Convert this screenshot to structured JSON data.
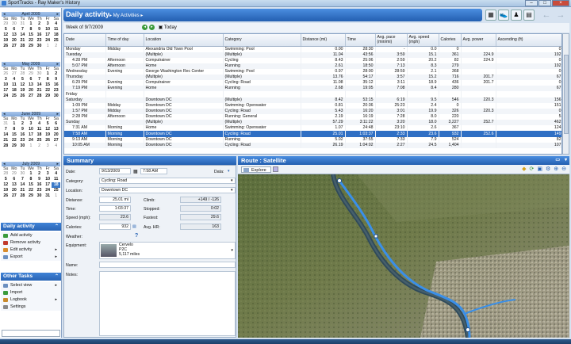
{
  "app": {
    "title": "SportTracks - Ray Maker's History"
  },
  "calendars": [
    {
      "month": "April 2009",
      "dow": [
        "Su",
        "Mo",
        "Tu",
        "We",
        "Th",
        "Fr",
        "Sa"
      ],
      "days": [
        "29",
        "30",
        "31",
        "1",
        "2",
        "3",
        "4",
        "5",
        "6",
        "7",
        "8",
        "9",
        "10",
        "11",
        "12",
        "13",
        "14",
        "15",
        "16",
        "17",
        "18",
        "19",
        "20",
        "21",
        "22",
        "23",
        "24",
        "25",
        "26",
        "27",
        "28",
        "29",
        "30",
        "1",
        "2"
      ]
    },
    {
      "month": "May 2009",
      "dow": [
        "Su",
        "Mo",
        "Tu",
        "We",
        "Th",
        "Fr",
        "Sa"
      ],
      "days": [
        "26",
        "27",
        "28",
        "29",
        "30",
        "1",
        "2",
        "3",
        "4",
        "5",
        "6",
        "7",
        "8",
        "9",
        "10",
        "11",
        "12",
        "13",
        "14",
        "15",
        "16",
        "17",
        "18",
        "19",
        "20",
        "21",
        "22",
        "23",
        "24",
        "25",
        "26",
        "27",
        "28",
        "29",
        "30"
      ]
    },
    {
      "month": "June 2009",
      "dow": [
        "Su",
        "Mo",
        "Tu",
        "We",
        "Th",
        "Fr",
        "Sa"
      ],
      "days": [
        "31",
        "1",
        "2",
        "3",
        "4",
        "5",
        "6",
        "7",
        "8",
        "9",
        "10",
        "11",
        "12",
        "13",
        "14",
        "15",
        "16",
        "17",
        "18",
        "19",
        "20",
        "21",
        "22",
        "23",
        "24",
        "25",
        "26",
        "27",
        "28",
        "29",
        "30",
        "1",
        "2",
        "3",
        "4"
      ]
    },
    {
      "month": "July 2009",
      "dow": [
        "Su",
        "Mo",
        "Tu",
        "We",
        "Th",
        "Fr",
        "Sa"
      ],
      "days": [
        "28",
        "29",
        "30",
        "1",
        "2",
        "3",
        "4",
        "5",
        "6",
        "7",
        "8",
        "9",
        "10",
        "11",
        "12",
        "13",
        "14",
        "15",
        "16",
        "17",
        "18",
        "19",
        "20",
        "21",
        "22",
        "23",
        "24",
        "25",
        "26",
        "27",
        "28",
        "29",
        "30",
        "31",
        "1"
      ]
    }
  ],
  "daily_panel": {
    "title": "Daily activity",
    "items": [
      {
        "label": "Add activity",
        "icon": "add-icon",
        "color": "#3a9a3a"
      },
      {
        "label": "Remove activity",
        "icon": "remove-icon",
        "color": "#c0392b"
      },
      {
        "label": "Edit activity",
        "icon": "edit-icon",
        "color": "#d98c2b",
        "sub": "▸"
      },
      {
        "label": "Export",
        "icon": "export-icon",
        "color": "#6b8fbf",
        "sub": "▸"
      }
    ]
  },
  "other_panel": {
    "title": "Other Tasks",
    "items": [
      {
        "label": "Select view",
        "icon": "select-view-icon",
        "color": "#6b8fbf",
        "sub": "▸"
      },
      {
        "label": "Import",
        "icon": "import-icon",
        "color": "#3a9a3a"
      },
      {
        "label": "Logbook",
        "icon": "logbook-icon",
        "color": "#c98a2b",
        "sub": "▸"
      },
      {
        "label": "Settings",
        "icon": "settings-icon",
        "color": "#888888"
      }
    ]
  },
  "header": {
    "title": "Daily activity",
    "breadcrumb": "▸ My Activities ▸"
  },
  "weekbar": {
    "week": "Week of 9/7/2009",
    "today": "Today"
  },
  "grid": {
    "columns": [
      "Date",
      "Time of day",
      "Location",
      "Category",
      "Distance (mi)",
      "Time",
      "Avg. pace (min/mi)",
      "Avg. speed (mph)",
      "Calories",
      "Avg. power",
      "Ascending (ft)"
    ],
    "rows": [
      [
        "Monday",
        "Midday",
        "Alexandria Old Town Pool",
        "Swimming: Pool",
        "0.00",
        "28:30",
        "-",
        "0.0",
        "0",
        "",
        "0"
      ],
      [
        "Tuesday",
        "",
        "(Multiple)",
        "(Multiple)",
        "11.04",
        "43:56",
        "3:59",
        "15.1",
        "361",
        "224.9",
        "192"
      ],
      [
        "4:28 PM",
        "Afternoon",
        "Computrainer",
        "Cycling",
        "8.43",
        "25:06",
        "2:59",
        "20.2",
        "82",
        "224.9",
        "0"
      ],
      [
        "5:07 PM",
        "Afternoon",
        "Home",
        "Running",
        "2.61",
        "18:50",
        "7:13",
        "8.3",
        "279",
        "",
        "192"
      ],
      [
        "Wednesday",
        "Evening",
        "George Washington Rec Center",
        "Swimming: Pool",
        "0.97",
        "28:00",
        "28:59",
        "2.1",
        "368",
        "",
        "0"
      ],
      [
        "Thursday",
        "",
        "(Multiple)",
        "(Multiple)",
        "13.76",
        "54:17",
        "3:57",
        "15.2",
        "716",
        "201.7",
        "67"
      ],
      [
        "6:29 PM",
        "Evening",
        "Computrainer",
        "Cycling: Road",
        "11.08",
        "35:12",
        "3:11",
        "18.9",
        "436",
        "201.7",
        "0"
      ],
      [
        "7:19 PM",
        "Evening",
        "Home",
        "Running",
        "2.68",
        "19:05",
        "7:08",
        "8.4",
        "280",
        "",
        "67"
      ],
      [
        "Friday",
        "",
        "",
        "",
        "",
        "",
        "",
        "",
        "",
        "",
        ""
      ],
      [
        "Saturday",
        "",
        "Downtown DC",
        "(Multiple)",
        "8.42",
        "53:15",
        "6:19",
        "9.5",
        "546",
        "220.3",
        "156"
      ],
      [
        "1:09 PM",
        "Midday",
        "Downtown DC",
        "Swimming: Openwater",
        "0.81",
        "20:36",
        "25:23",
        "2.4",
        "0",
        "",
        "151"
      ],
      [
        "1:57 PM",
        "Midday",
        "Downtown DC",
        "Cycling: Road",
        "5.43",
        "16:20",
        "3:01",
        "19.9",
        "326",
        "220.3",
        "0"
      ],
      [
        "2:28 PM",
        "Afternoon",
        "Downtown DC",
        "Running: General",
        "2.19",
        "16:19",
        "7:28",
        "8.0",
        "220",
        "",
        "5"
      ],
      [
        "Sunday",
        "",
        "(Multiple)",
        "(Multiple)",
        "57.29",
        "3:11:22",
        "3:20",
        "18.0",
        "3,227",
        "252.7",
        "462"
      ],
      [
        "7:31 AM",
        "Morning",
        "Home",
        "Swimming: Openwater",
        "1.07",
        "24:48",
        "23:10",
        "2.6",
        "367",
        "",
        "124"
      ],
      [
        "7:58 AM",
        "Morning",
        "Downtown DC",
        "Cycling: Road",
        "25.01",
        "1:03:37",
        "2:33",
        "23.6",
        "932",
        "252.6",
        "149"
      ],
      [
        "9:13 AM",
        "Morning",
        "Downtown DC",
        "Running",
        "5.02",
        "37:55",
        "7:33",
        "7.9",
        "524",
        "",
        "82"
      ],
      [
        "10:05 AM",
        "Morning",
        "Downtown DC",
        "Cycling: Road",
        "26.19",
        "1:04:02",
        "2:27",
        "24.5",
        "1,404",
        "",
        "107"
      ]
    ]
  },
  "summary": {
    "title": "Summary",
    "date_label": "Date:",
    "date": "9/13/2009",
    "time": "7:58 AM",
    "data_label": "Data:",
    "category_label": "Category:",
    "category": "Cycling: Road",
    "location_label": "Location:",
    "location": "Downtown DC",
    "distance_label": "Distance:",
    "distance": "25.01 mi",
    "climb_label": "Climb:",
    "climb": "+149 / -126",
    "time_label": "Time:",
    "time_val": "1:03:37",
    "stopped_label": "Stopped:",
    "stopped": "0:02",
    "speed_label": "Speed (mph):",
    "speed": "23.6",
    "fastest_label": "Fastest:",
    "fastest": "29.6",
    "calories_label": "Calories:",
    "calories": "932",
    "hr_label": "Avg. HR:",
    "hr": "163",
    "weather_label": "Weather:",
    "equipment_label": "Equipment:",
    "equip_name": "Cervelo",
    "equip_model": "P2C",
    "equip_miles": "5,117 miles",
    "name_label": "Name:",
    "notes_label": "Notes:"
  },
  "route": {
    "title": "Route : Satellite",
    "explore": "Explore"
  },
  "colors": {
    "accent": "#2a65b5",
    "selected_row": "#2f6fc4",
    "route": "#3a8fe8"
  }
}
